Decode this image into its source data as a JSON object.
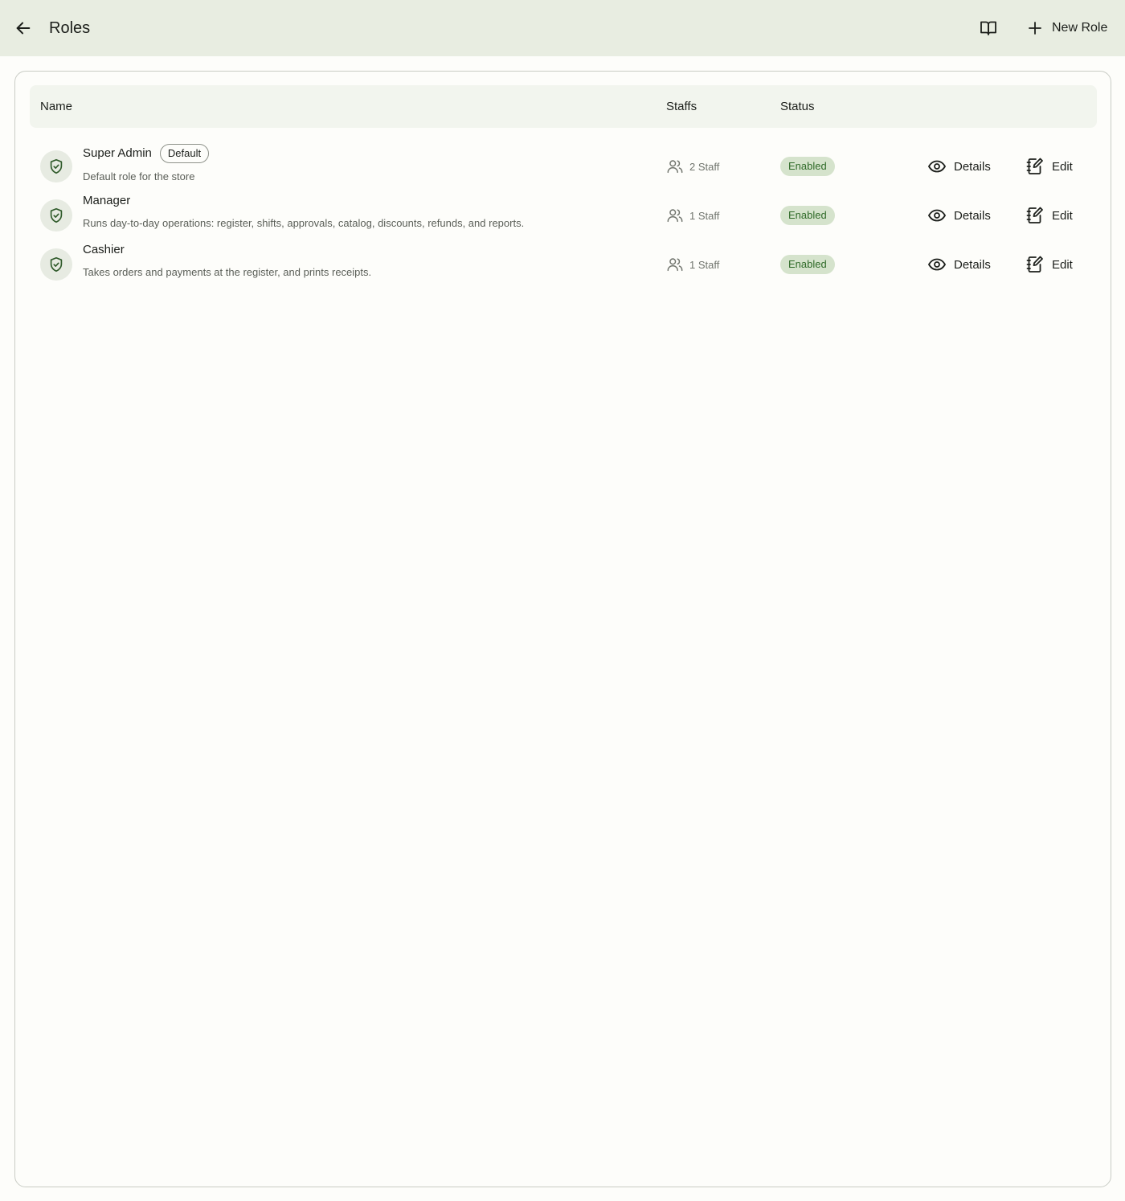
{
  "header": {
    "title": "Roles",
    "back_icon": "arrow-left-icon",
    "docs_icon": "book-open-icon",
    "new_role_label": "New Role",
    "new_role_icon": "plus-icon"
  },
  "table": {
    "columns": {
      "name": "Name",
      "staffs": "Staffs",
      "status": "Status"
    },
    "rows": [
      {
        "name": "Super Admin",
        "badge": "Default",
        "description": "Default role for the store",
        "staff": "2 Staff",
        "status": "Enabled",
        "details_label": "Details",
        "edit_label": "Edit"
      },
      {
        "name": "Manager",
        "badge": "",
        "description": "Runs day-to-day operations: register, shifts, approvals, catalog, discounts, refunds, and reports.",
        "staff": "1 Staff",
        "status": "Enabled",
        "details_label": "Details",
        "edit_label": "Edit"
      },
      {
        "name": "Cashier",
        "badge": "",
        "description": "Takes orders and payments at the register, and prints receipts.",
        "staff": "1 Staff",
        "status": "Enabled",
        "details_label": "Details",
        "edit_label": "Edit"
      }
    ]
  },
  "colors": {
    "header_bg": "#e8ede1",
    "status_bg": "#d5e3cc",
    "status_text": "#2f6a28",
    "avatar_bg": "#e7ebe2",
    "shield": "#2f5a2a"
  }
}
